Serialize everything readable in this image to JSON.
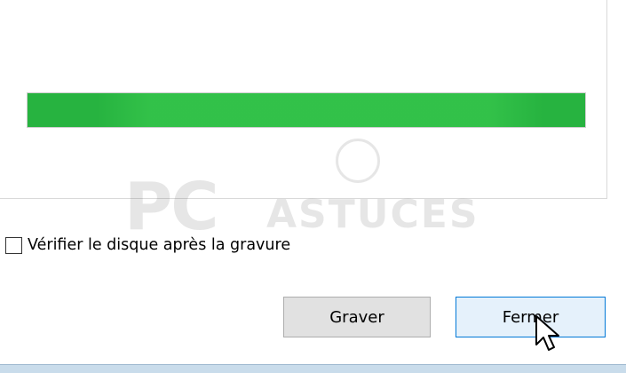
{
  "progress": {
    "status_text": "",
    "value_percent": 100,
    "fill_color": "#27b340"
  },
  "watermark": {
    "big": "PC",
    "small": "ASTUCES"
  },
  "verify": {
    "label": "Vérifier le disque après la gravure",
    "checked": false
  },
  "buttons": {
    "burn_label": "Graver",
    "close_label": "Fermer"
  },
  "colors": {
    "accent": "#0078d7",
    "button_face": "#e1e1e1"
  },
  "icons": {
    "cursor": "mouse-pointer-icon"
  }
}
